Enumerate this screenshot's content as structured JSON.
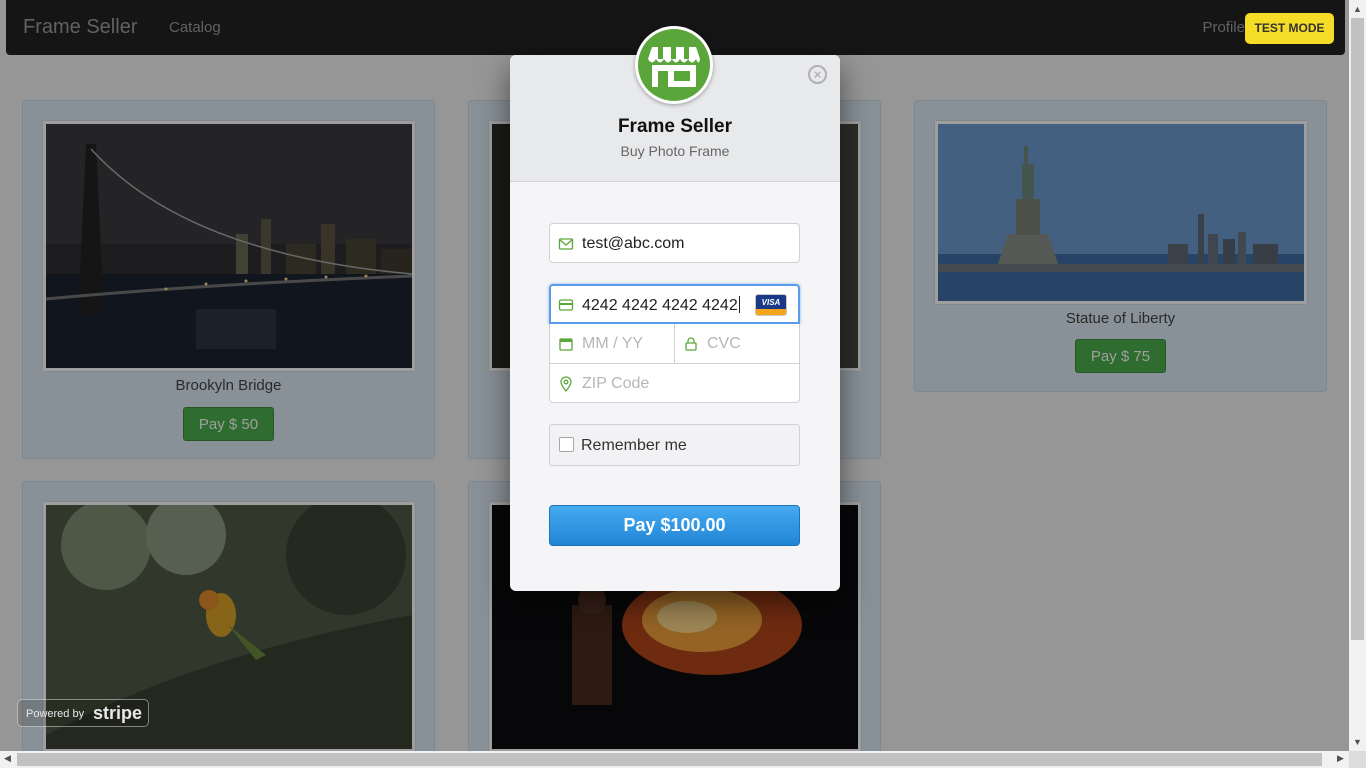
{
  "navbar": {
    "brand": "Frame Seller",
    "catalog": "Catalog",
    "profile": "Profile",
    "test_mode": "TEST MODE"
  },
  "products": [
    {
      "caption": "Brookyln Bridge",
      "pay_label": "Pay $ 50"
    },
    {
      "caption": "",
      "pay_label": ""
    },
    {
      "caption": "Statue of Liberty",
      "pay_label": "Pay $ 75"
    }
  ],
  "powered": {
    "prefix": "Powered by",
    "brand": "stripe"
  },
  "checkout": {
    "title": "Frame Seller",
    "subtitle": "Buy Photo Frame",
    "email_value": "test@abc.com",
    "card_number": "4242 4242 4242 4242",
    "card_brand": "VISA",
    "expiry_placeholder": "MM / YY",
    "cvc_placeholder": "CVC",
    "zip_placeholder": "ZIP Code",
    "remember_label": "Remember me",
    "pay_label": "Pay $100.00",
    "close_glyph": "×"
  },
  "colors": {
    "accent_green": "#4cae4c",
    "stripe_blue": "#2185d6",
    "logo_green": "#5aa63a",
    "test_badge": "#f5dc26"
  },
  "icons": [
    "envelope-icon",
    "credit-card-icon",
    "calendar-icon",
    "lock-icon",
    "location-pin-icon",
    "close-icon",
    "storefront-icon"
  ]
}
